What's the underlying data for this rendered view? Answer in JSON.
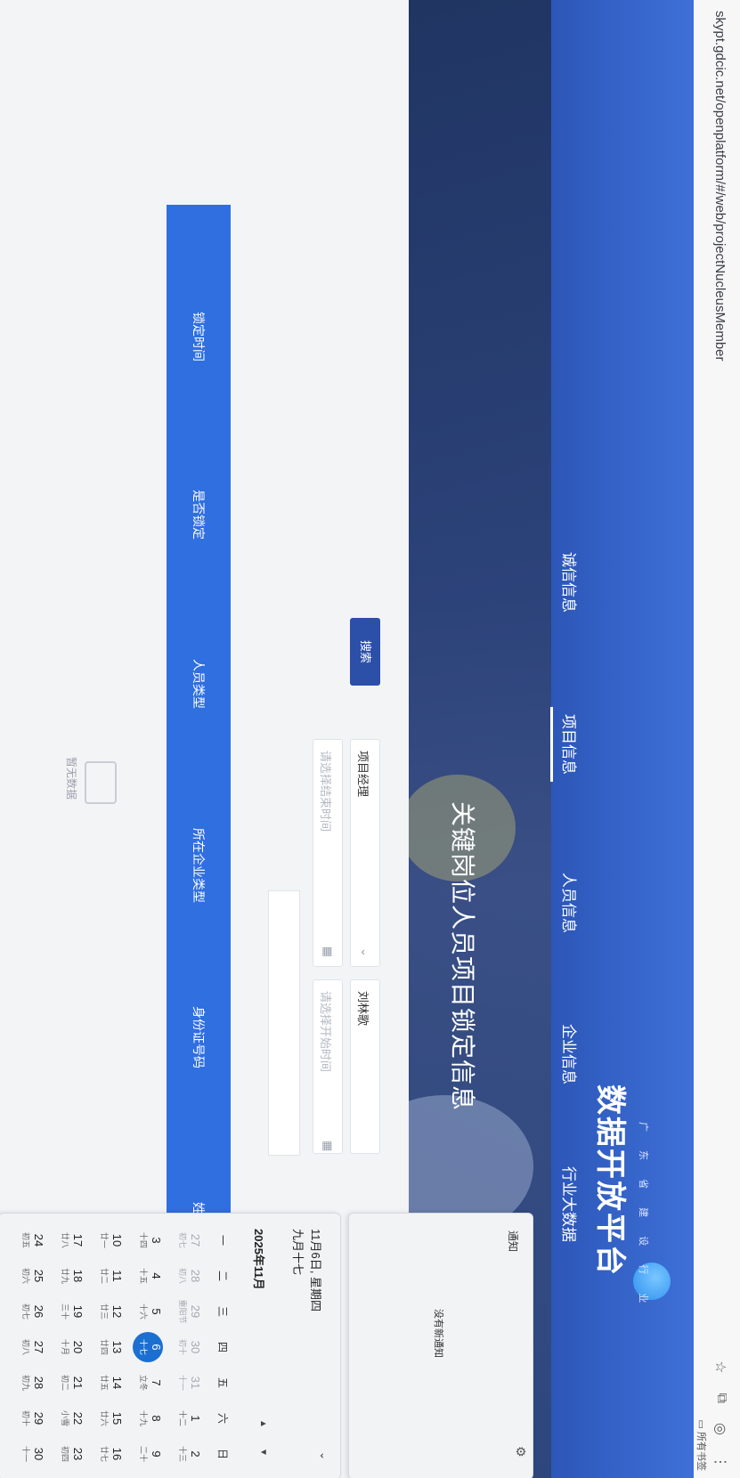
{
  "browser": {
    "url": "skypt.gdcic.net/openplatform/#/web/projectNucleusMember",
    "bookmarks": "所有书签"
  },
  "logo": {
    "subtitle": "广 东 省 建 设 行 业",
    "title": "数据开放平台"
  },
  "nav": {
    "items": [
      "行业大数据",
      "企业信息",
      "人员信息",
      "项目信息",
      "诚信信息"
    ],
    "active_index": 3
  },
  "page": {
    "heading": "关键岗位人员项目锁定信息"
  },
  "search": {
    "name_value": "刘林歌",
    "role_value": "项目经理",
    "start_placeholder": "请选择开始时间",
    "end_placeholder": "请选择结束时间",
    "button_label": "搜索"
  },
  "table": {
    "columns": [
      "姓名",
      "身份证号码",
      "所在企业类型",
      "人员类型",
      "是否锁定",
      "锁定时间"
    ],
    "empty_text": "暂无数据"
  },
  "notification": {
    "title": "通知",
    "empty": "没有新通知"
  },
  "calendar": {
    "date_line": "11月6日, 星期四",
    "lunar_line": "九月十七",
    "month_label": "2025年11月",
    "weekdays": [
      "一",
      "二",
      "三",
      "四",
      "五",
      "六",
      "日"
    ],
    "weeks": [
      [
        {
          "n": "27",
          "l": "初七",
          "dim": true
        },
        {
          "n": "28",
          "l": "初八",
          "dim": true
        },
        {
          "n": "29",
          "l": "重阳节",
          "dim": true
        },
        {
          "n": "30",
          "l": "初十",
          "dim": true
        },
        {
          "n": "31",
          "l": "十一",
          "dim": true
        },
        {
          "n": "1",
          "l": "十二"
        },
        {
          "n": "2",
          "l": "十三"
        }
      ],
      [
        {
          "n": "3",
          "l": "十四"
        },
        {
          "n": "4",
          "l": "十五"
        },
        {
          "n": "5",
          "l": "十六"
        },
        {
          "n": "6",
          "l": "十七",
          "today": true
        },
        {
          "n": "7",
          "l": "立冬"
        },
        {
          "n": "8",
          "l": "十九"
        },
        {
          "n": "9",
          "l": "二十"
        }
      ],
      [
        {
          "n": "10",
          "l": "廿一"
        },
        {
          "n": "11",
          "l": "廿二"
        },
        {
          "n": "12",
          "l": "廿三"
        },
        {
          "n": "13",
          "l": "廿四"
        },
        {
          "n": "14",
          "l": "廿五"
        },
        {
          "n": "15",
          "l": "廿六"
        },
        {
          "n": "16",
          "l": "廿七"
        }
      ],
      [
        {
          "n": "17",
          "l": "廿八"
        },
        {
          "n": "18",
          "l": "廿九"
        },
        {
          "n": "19",
          "l": "三十"
        },
        {
          "n": "20",
          "l": "十月"
        },
        {
          "n": "21",
          "l": "初二"
        },
        {
          "n": "22",
          "l": "小雪"
        },
        {
          "n": "23",
          "l": "初四"
        }
      ],
      [
        {
          "n": "24",
          "l": "初五"
        },
        {
          "n": "25",
          "l": "初六"
        },
        {
          "n": "26",
          "l": "初七"
        },
        {
          "n": "27",
          "l": "初八"
        },
        {
          "n": "28",
          "l": "初九"
        },
        {
          "n": "29",
          "l": "初十"
        },
        {
          "n": "30",
          "l": "十一"
        }
      ]
    ]
  }
}
